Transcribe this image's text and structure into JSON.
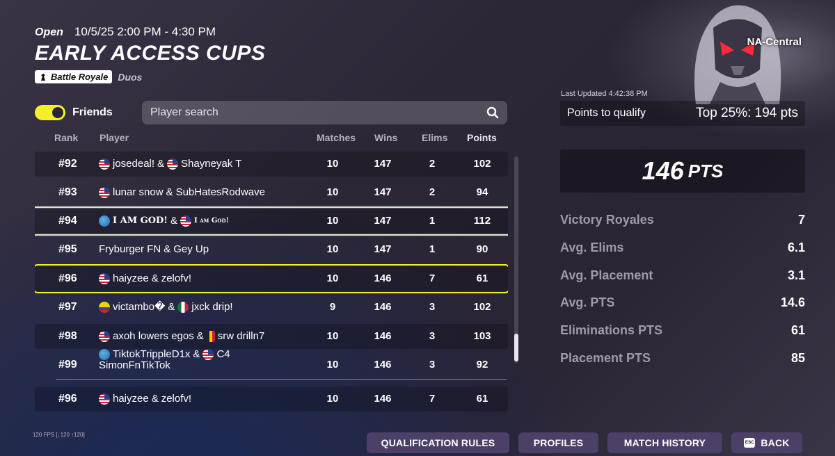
{
  "event": {
    "status": "Open",
    "date_range": "10/5/25 2:00 PM - 4:30 PM",
    "title": "EARLY ACCESS CUPS",
    "mode": "Battle Royale",
    "team_size": "Duos",
    "region": "NA-Central"
  },
  "filters": {
    "friends_label": "Friends",
    "friends_on": true,
    "search_placeholder": "Player search"
  },
  "columns": {
    "rank": "Rank",
    "player": "Player",
    "matches": "Matches",
    "wins": "Wins",
    "elims": "Elims",
    "points": "Points"
  },
  "rows": [
    {
      "rank": "#92",
      "p1_flag": "us-flag-icon",
      "p1": "josedeal!",
      "p2_flag": "us-flag-icon",
      "p2": "Shayneyak T",
      "matches": "10",
      "wins": "147",
      "elims": "2",
      "points": "102"
    },
    {
      "rank": "#93",
      "p1_flag": "us-flag-icon",
      "p1": "lunar snow",
      "p2_flag": "",
      "p2": "SubHatesRodwave",
      "matches": "10",
      "wins": "147",
      "elims": "2",
      "points": "94"
    },
    {
      "rank": "#94",
      "p1_flag": "globe-icon",
      "p1": "I AM GOD!",
      "p2_flag": "us-flag-icon",
      "p2": "I am God!",
      "matches": "10",
      "wins": "147",
      "elims": "1",
      "points": "112"
    },
    {
      "rank": "#95",
      "p1_flag": "",
      "p1": "Fryburger FN",
      "p2_flag": "",
      "p2": "Gey Up",
      "matches": "10",
      "wins": "147",
      "elims": "1",
      "points": "90"
    },
    {
      "rank": "#96",
      "p1_flag": "us-flag-icon",
      "p1": "haiyzee",
      "p2_flag": "",
      "p2": "zelofv!",
      "matches": "10",
      "wins": "146",
      "elims": "7",
      "points": "61"
    },
    {
      "rank": "#97",
      "p1_flag": "colombia-flag-icon",
      "p1": "victambo�",
      "p2_flag": "mexico-flag-icon",
      "p2": "jxck drip!",
      "matches": "9",
      "wins": "146",
      "elims": "3",
      "points": "102"
    },
    {
      "rank": "#98",
      "p1_flag": "us-flag-icon",
      "p1": "axoh lowers egos",
      "p2_flag": "belgium-flag-icon",
      "p2": "srw drilln7",
      "matches": "10",
      "wins": "146",
      "elims": "3",
      "points": "103"
    },
    {
      "rank": "#99",
      "p1_flag": "globe-icon",
      "p1": "TiktokTrippleD1x",
      "p2_flag": "us-flag-icon",
      "p2": "C4",
      "p2_line2": "SimonFnTikTok",
      "matches": "10",
      "wins": "146",
      "elims": "3",
      "points": "92"
    }
  ],
  "pinned_row": {
    "rank": "#96",
    "p1": "haiyzee",
    "p2": "zelofv!",
    "matches": "10",
    "wins": "146",
    "elims": "7",
    "points": "61"
  },
  "sep": "&",
  "summary": {
    "last_updated": "Last Updated 4:42:38 PM",
    "qualify_label": "Points to qualify",
    "qualify_value": "Top 25%: 194 pts",
    "total_points": "146",
    "total_unit": "PTS",
    "stats": [
      {
        "label": "Victory Royales",
        "value": "7"
      },
      {
        "label": "Avg. Elims",
        "value": "6.1"
      },
      {
        "label": "Avg. Placement",
        "value": "3.1"
      },
      {
        "label": "Avg. PTS",
        "value": "14.6"
      },
      {
        "label": "Eliminations PTS",
        "value": "61"
      },
      {
        "label": "Placement PTS",
        "value": "85"
      }
    ]
  },
  "footer": {
    "fps": "120 FPS [↓120 ↑120]",
    "qualification_rules": "QUALIFICATION RULES",
    "profiles": "PROFILES",
    "match_history": "MATCH HISTORY",
    "esc_key": "ESC",
    "back": "BACK"
  },
  "colors": {
    "accent_yellow": "#f3f02a",
    "button_purple": "#4d4068",
    "stat_label": "#9f99a9"
  }
}
